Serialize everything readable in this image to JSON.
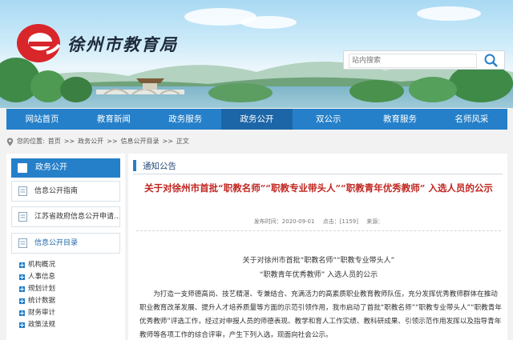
{
  "header": {
    "site_name": "徐州市教育局",
    "search": {
      "placeholder": "站内搜索"
    }
  },
  "nav": {
    "items": [
      "网站首页",
      "教育新闻",
      "政务服务",
      "政务公开",
      "双公示",
      "教育服务",
      "名师风采"
    ],
    "active_index": 3
  },
  "breadcrumb": {
    "prefix": "您的位置:",
    "items": [
      "首页",
      "政务公开",
      "信息公开目录",
      "正文"
    ],
    "separator": ">>"
  },
  "sidebar": {
    "section_title": "政务公开",
    "links": [
      "信息公开指南",
      "江苏省政府信息公开申请..."
    ],
    "catalog_title": "信息公开目录",
    "catalog_items": [
      "机构概况",
      "人事信息",
      "规划计划",
      "统计数据",
      "财务审计",
      "政策法规"
    ]
  },
  "article": {
    "tab_label": "通知公告",
    "title": "关于对徐州市首批“职教名师”“职教专业带头人”“职教青年优秀教师” 入选人员的公示",
    "meta": {
      "date": "发布时间：2020-09-01",
      "views": "点击：[1159]",
      "source": "来源："
    },
    "subtitle_1": "关于对徐州市首批“职教名师”“职教专业带头人”",
    "subtitle_2": "“职教青年优秀教师” 入选人员的公示",
    "body": "为打造一支师德高尚、技艺精湛、专兼结合、充满活力的高素质职业教育教师队伍，充分发挥优秀教师群体在推动职业教育改革发展、提升人才培养质量等方面的示范引领作用，我市启动了首批“职教名师”“职教专业带头人”“职教青年优秀教师”评选工作，经过对申报人员的师德表现、教学和育人工作实绩、教科研成果、引领示范作用发挥以及指导青年教师等各项工作的综合评审，产生下列入选，现面向社会公示。"
  },
  "colors": {
    "nav_blue": "#2580c9",
    "title_red": "#c0251f",
    "logo_red": "#d8262a"
  }
}
